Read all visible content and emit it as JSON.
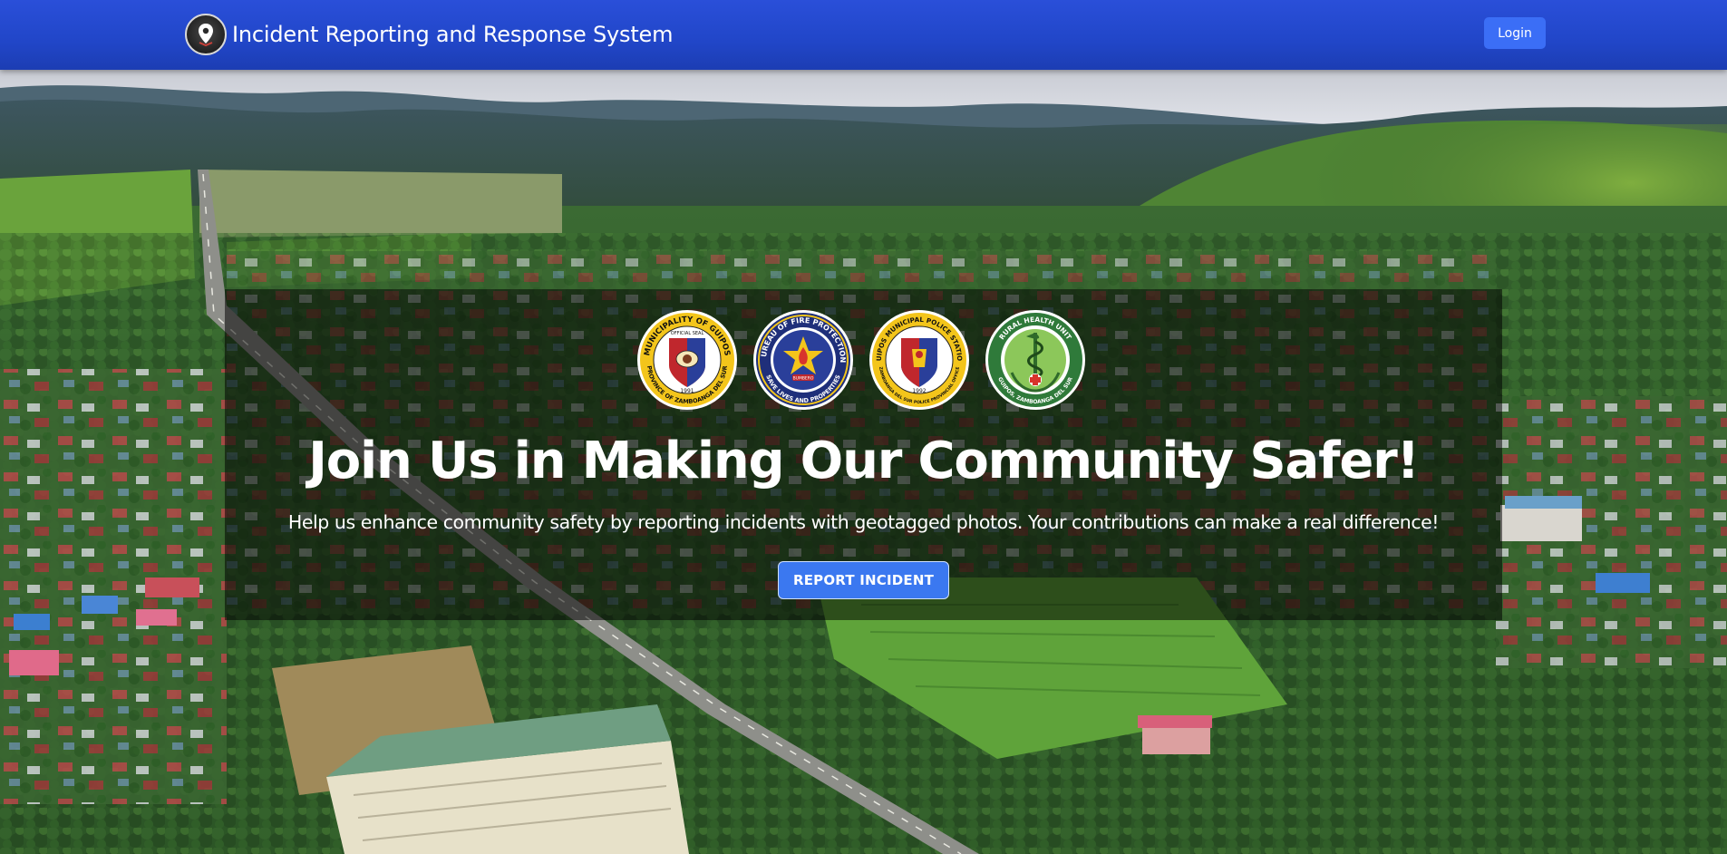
{
  "app": {
    "title": "Incident Reporting and Response System",
    "logo_icon": "location-pin-shield-icon"
  },
  "navbar": {
    "login_label": "Login"
  },
  "hero": {
    "background": "aerial-town-landscape-photo",
    "title": "Join Us in Making Our Community Safer!",
    "subtitle": "Help us enhance community safety by reporting incidents with geotagged photos. Your contributions can make a real difference!",
    "cta_label": "REPORT INCIDENT",
    "seals": [
      {
        "name": "municipality-of-guipos-seal",
        "top_text": "MUNICIPALITY OF GUIPOS",
        "bottom_text": "PROVINCE OF ZAMBOANGA DEL SUR",
        "inner_text": "OFFICIAL SEAL",
        "year": "1991"
      },
      {
        "name": "bureau-of-fire-protection-seal",
        "top_text": "BUREAU OF FIRE PROTECTION",
        "bottom_text": "SAVE LIVES AND PROPERTIES",
        "inner_text": "BUMBERO",
        "year": ""
      },
      {
        "name": "guipos-municipal-police-station-seal",
        "top_text": "GUIPOS MUNICIPAL POLICE STATION",
        "bottom_text": "ZAMBOANGA DEL SUR POLICE PROVINCIAL OFFICE",
        "inner_text": "",
        "year": "1992"
      },
      {
        "name": "rural-health-unit-seal",
        "top_text": "RURAL HEALTH UNIT",
        "bottom_text": "GUIPOS, ZAMBOANGA DEL SUR",
        "inner_text": "",
        "year": ""
      }
    ]
  },
  "colors": {
    "navbar": "#2146c8",
    "button": "#3b6ef6",
    "cta": "#3b78f0",
    "overlay": "rgba(0,0,0,0.52)"
  }
}
